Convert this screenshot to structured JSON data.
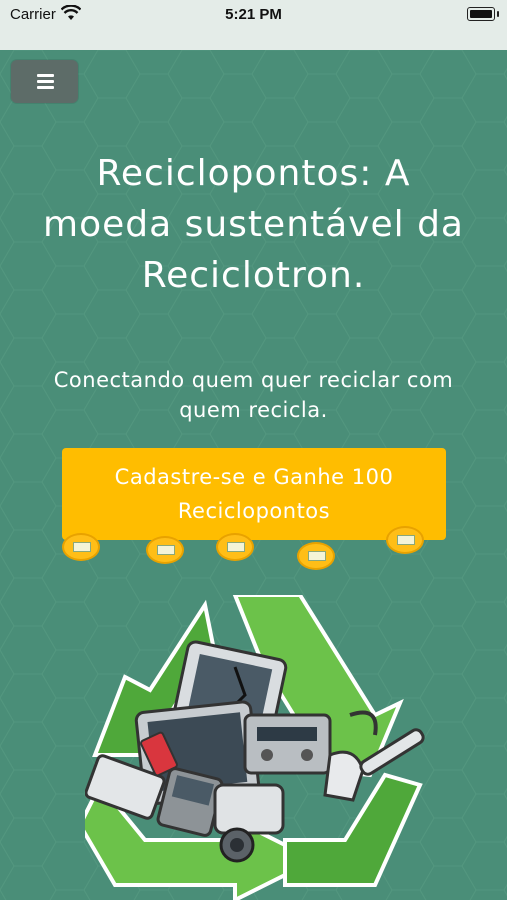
{
  "status_bar": {
    "carrier": "Carrier",
    "time": "5:21 PM"
  },
  "menu": {
    "icon": "hamburger-menu-icon"
  },
  "hero": {
    "headline": "Reciclopontos: A moeda sustentável da Reciclotron.",
    "subtitle": "Conectando quem quer reciclar com quem recicla.",
    "cta_label": "Cadastre-se e Ganhe 100 Reciclopontos"
  },
  "colors": {
    "background": "#4a8e78",
    "cta": "#ffbd00",
    "menu_button": "#5d6c68",
    "recycle_green": "#6cc24a"
  },
  "icons": [
    "wifi-icon",
    "battery-icon",
    "hamburger-menu-icon",
    "coin-icon",
    "recycle-electronics-illustration"
  ]
}
